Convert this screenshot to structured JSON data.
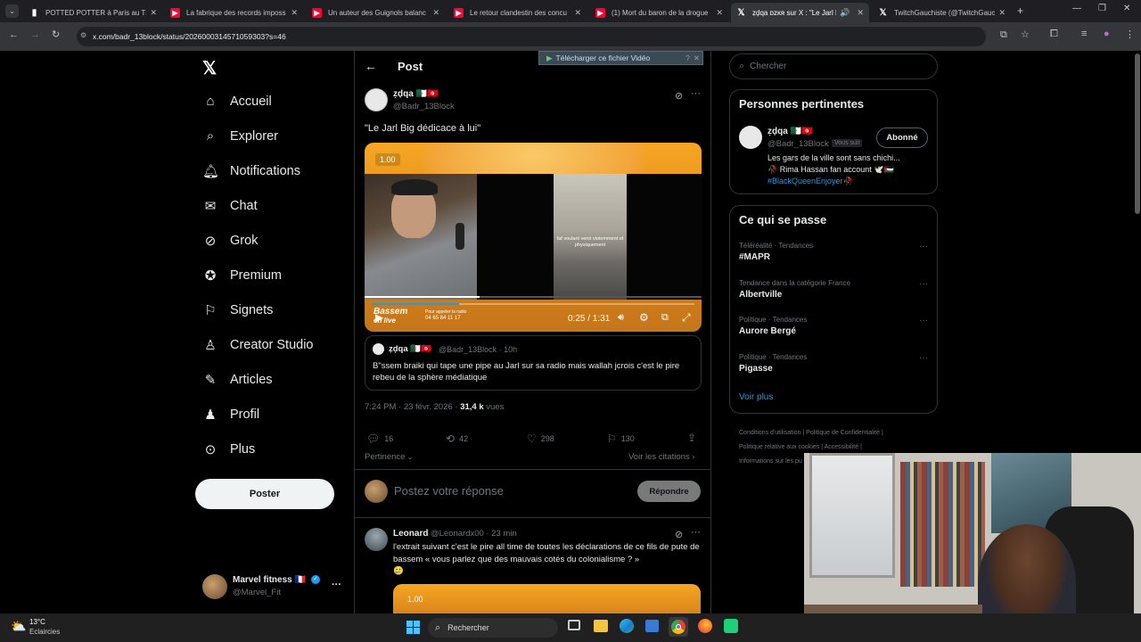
{
  "browser": {
    "tabs": [
      {
        "title": "POTTED POTTER à Paris au Thé",
        "favicon": "site-icon"
      },
      {
        "title": "La fabrique des records imposs",
        "favicon": "youtube-icon"
      },
      {
        "title": "Un auteur des Guignols balanc",
        "favicon": "youtube-icon"
      },
      {
        "title": "Le retour clandestin des concu",
        "favicon": "youtube-icon"
      },
      {
        "title": "(1) Mort du baron de la drogue",
        "favicon": "youtube-icon"
      },
      {
        "title": "ẓḑqa ᴅᴢᴋʀ sur X : \"Le Jarl B",
        "favicon": "x-icon"
      },
      {
        "title": "TwitchGauchiste (@TwitchGauc",
        "favicon": "x-icon"
      }
    ],
    "url": "x.com/badr_13block/status/2026000314571059303?s=46",
    "download_overlay": "Télécharger ce fichier Vidéo"
  },
  "nav": {
    "items": [
      {
        "label": "Accueil",
        "icon": "home-icon"
      },
      {
        "label": "Explorer",
        "icon": "search-icon"
      },
      {
        "label": "Notifications",
        "icon": "bell-icon"
      },
      {
        "label": "Chat",
        "icon": "mail-icon"
      },
      {
        "label": "Grok",
        "icon": "grok-icon"
      },
      {
        "label": "Premium",
        "icon": "verified-icon"
      },
      {
        "label": "Signets",
        "icon": "bookmark-icon"
      },
      {
        "label": "Creator Studio",
        "icon": "creator-icon"
      },
      {
        "label": "Articles",
        "icon": "article-icon"
      },
      {
        "label": "Profil",
        "icon": "person-icon"
      },
      {
        "label": "Plus",
        "icon": "more-icon"
      }
    ],
    "post_button": "Poster",
    "account": {
      "name": "Marvel fitness 🇫🇷",
      "handle": "@Marvel_Fit"
    }
  },
  "post": {
    "header": "Post",
    "author_name": "ẓḑqa 🇩🇿🇹🇳",
    "author_handle": "@Badr_13Block",
    "text": "\"Le Jarl Big dédicace à lui\"",
    "video": {
      "badge": "1.00",
      "time": "0:25 / 1:31",
      "progress": 0.27,
      "overlay_caption": "faf voulant venir violemment et physiquement",
      "bottom_logo": "Bassem",
      "bottom_logo2": "en live",
      "bottom_phone_label": "Pour appeler la radio",
      "bottom_phone": "04 65 84 11 17"
    },
    "quote": {
      "name": "ẓḑqa 🇩🇿🇹🇳",
      "handle": "@Badr_13Block · 10h",
      "text": "B\"ssem braiki qui tape une pipe au Jarl sur sa radio mais wallah jcrois c'est le pire rebeu de la sphère médiatique"
    },
    "timestamp": "7:24 PM · 23 févr. 2026 ·",
    "views_count": "31,4 k",
    "views_label": "vues",
    "stats": {
      "replies": "16",
      "reposts": "42",
      "likes": "298",
      "bookmarks": "130"
    },
    "sort_label": "Pertinence",
    "citations_label": "Voir les citations",
    "reply_placeholder": "Postez votre réponse",
    "reply_button": "Répondre"
  },
  "reply": {
    "name": "Leonard",
    "handle": "@Leonardx00 · 23 min",
    "text": "l'extrait suivant c'est le pire all time de toutes les déclarations de ce fils de pute de bassem « vous parlez que des mauvais cotés du colonialisme ? »",
    "emoji": "🥲",
    "video_badge": "1.00"
  },
  "sidebar": {
    "search_placeholder": "Chercher",
    "relevant_title": "Personnes pertinentes",
    "person": {
      "name": "ẓḑqa 🇩🇿🇹🇳",
      "handle": "@Badr_13Block",
      "follows_you": "Vous suit",
      "button": "Abonné",
      "bio1": "Les gars de la ville sont sans chichi...",
      "bio2": "🥀 Rima Hassan fan account 🕊️🇵🇸",
      "bio3": "#BlackQueenEnjoyer🥀"
    },
    "trends_title": "Ce qui se passe",
    "trends": [
      {
        "category": "Téléréalité · Tendances",
        "name": "#MAPR"
      },
      {
        "category": "Tendance dans la catégorie France",
        "name": "Albertville"
      },
      {
        "category": "Politique · Tendances",
        "name": "Aurore Bergé"
      },
      {
        "category": "Politique · Tendances",
        "name": "Pigasse"
      }
    ],
    "see_more": "Voir plus",
    "footer": [
      "Conditions d'utilisation",
      "Politique de Confidentialité",
      "Politique relative aux cookies",
      "Accessibilité",
      "Informations sur les pu"
    ]
  },
  "taskbar": {
    "temp": "13°C",
    "weather": "Eclaircies",
    "search": "Rechercher"
  },
  "colors": {
    "accent": "#1d9bf0",
    "bg": "#000000",
    "border": "#2f3336"
  }
}
